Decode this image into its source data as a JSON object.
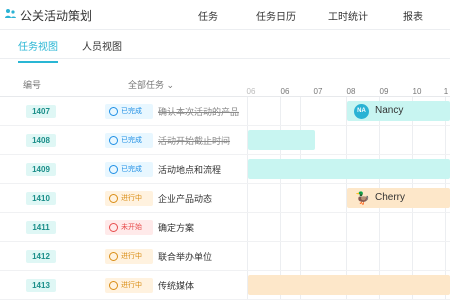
{
  "app": {
    "title": "公关活动策划",
    "icon_name": "team-icon",
    "nav": [
      "任务",
      "任务日历",
      "工时统计",
      "报表"
    ]
  },
  "view_tabs": {
    "items": [
      "任务视图",
      "人员视图"
    ],
    "active": "任务视图"
  },
  "table": {
    "columns": {
      "id": "编号",
      "task_filter": "全部任务"
    },
    "dates": [
      "06",
      "06",
      "07",
      "08",
      "09",
      "10",
      "1"
    ],
    "rows": [
      {
        "id": "1407",
        "status": "已完成",
        "state": "done",
        "task": "确认本次活动的产品"
      },
      {
        "id": "1408",
        "status": "已完成",
        "state": "done",
        "task": "活动开始截止时间"
      },
      {
        "id": "1409",
        "status": "已完成",
        "state": "done",
        "task": "活动地点和流程"
      },
      {
        "id": "1410",
        "status": "进行中",
        "state": "doing",
        "task": "企业产品动态"
      },
      {
        "id": "1411",
        "status": "未开始",
        "state": "todo",
        "task": "确定方案"
      },
      {
        "id": "1412",
        "status": "进行中",
        "state": "doing",
        "task": "联合举办单位"
      },
      {
        "id": "1413",
        "status": "进行中",
        "state": "doing",
        "task": "传统媒体"
      }
    ]
  },
  "timeline": {
    "assignee_nancy": {
      "initials": "NA",
      "name": "Nancy"
    },
    "assignee_cherry": {
      "name": "Cherry",
      "icon_name": "duck-icon"
    }
  },
  "colors": {
    "accent": "#29b6d4",
    "done": "#1f8fe5",
    "doing": "#d98d15",
    "todo": "#e74c4c",
    "bar_cyan": "#c8f5f1",
    "bar_peach": "#fde7c9"
  }
}
